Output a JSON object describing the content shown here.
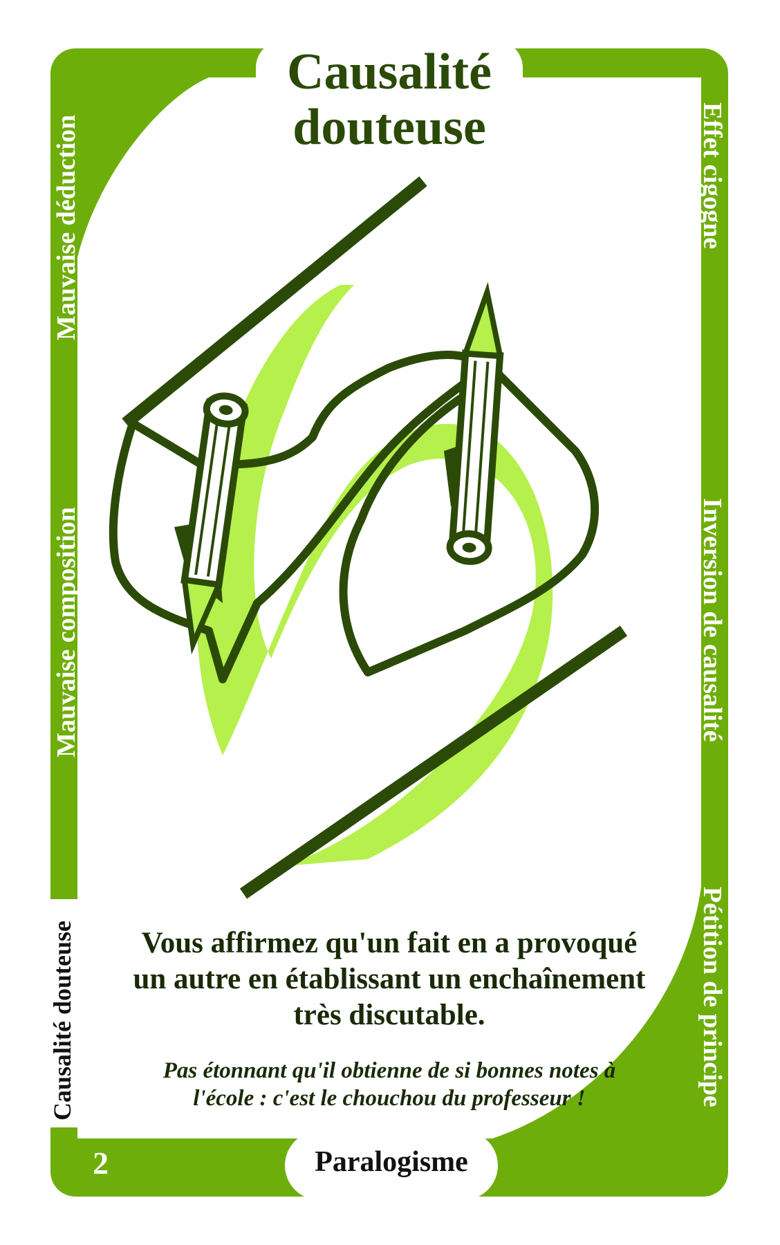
{
  "card": {
    "title_line1": "Causalité",
    "title_line2": "douteuse",
    "number": "2",
    "category": "Paralogisme",
    "description_lines": [
      "Vous affirmez qu'un fait en a provoqué",
      "un autre en établissant un enchaînement",
      "très discutable."
    ],
    "example_lines": [
      "Pas étonnant qu'il obtienne de si bonnes notes à",
      "l'école : c'est le chouchou du professeur !"
    ]
  },
  "side_labels": {
    "left_top": "Mauvaise déduction",
    "left_middle": "Mauvaise composition",
    "left_current": "Causalité douteuse",
    "right_top": "Effet cigogne",
    "right_middle": "Inversion de causalité",
    "right_bottom": "Pétition de principe"
  },
  "colors": {
    "frame_green": "#6eae0a",
    "light_green": "#b6f04c",
    "dark_ink": "#2b4a08"
  },
  "illustration": {
    "icon": "drawing-hands-icon"
  }
}
